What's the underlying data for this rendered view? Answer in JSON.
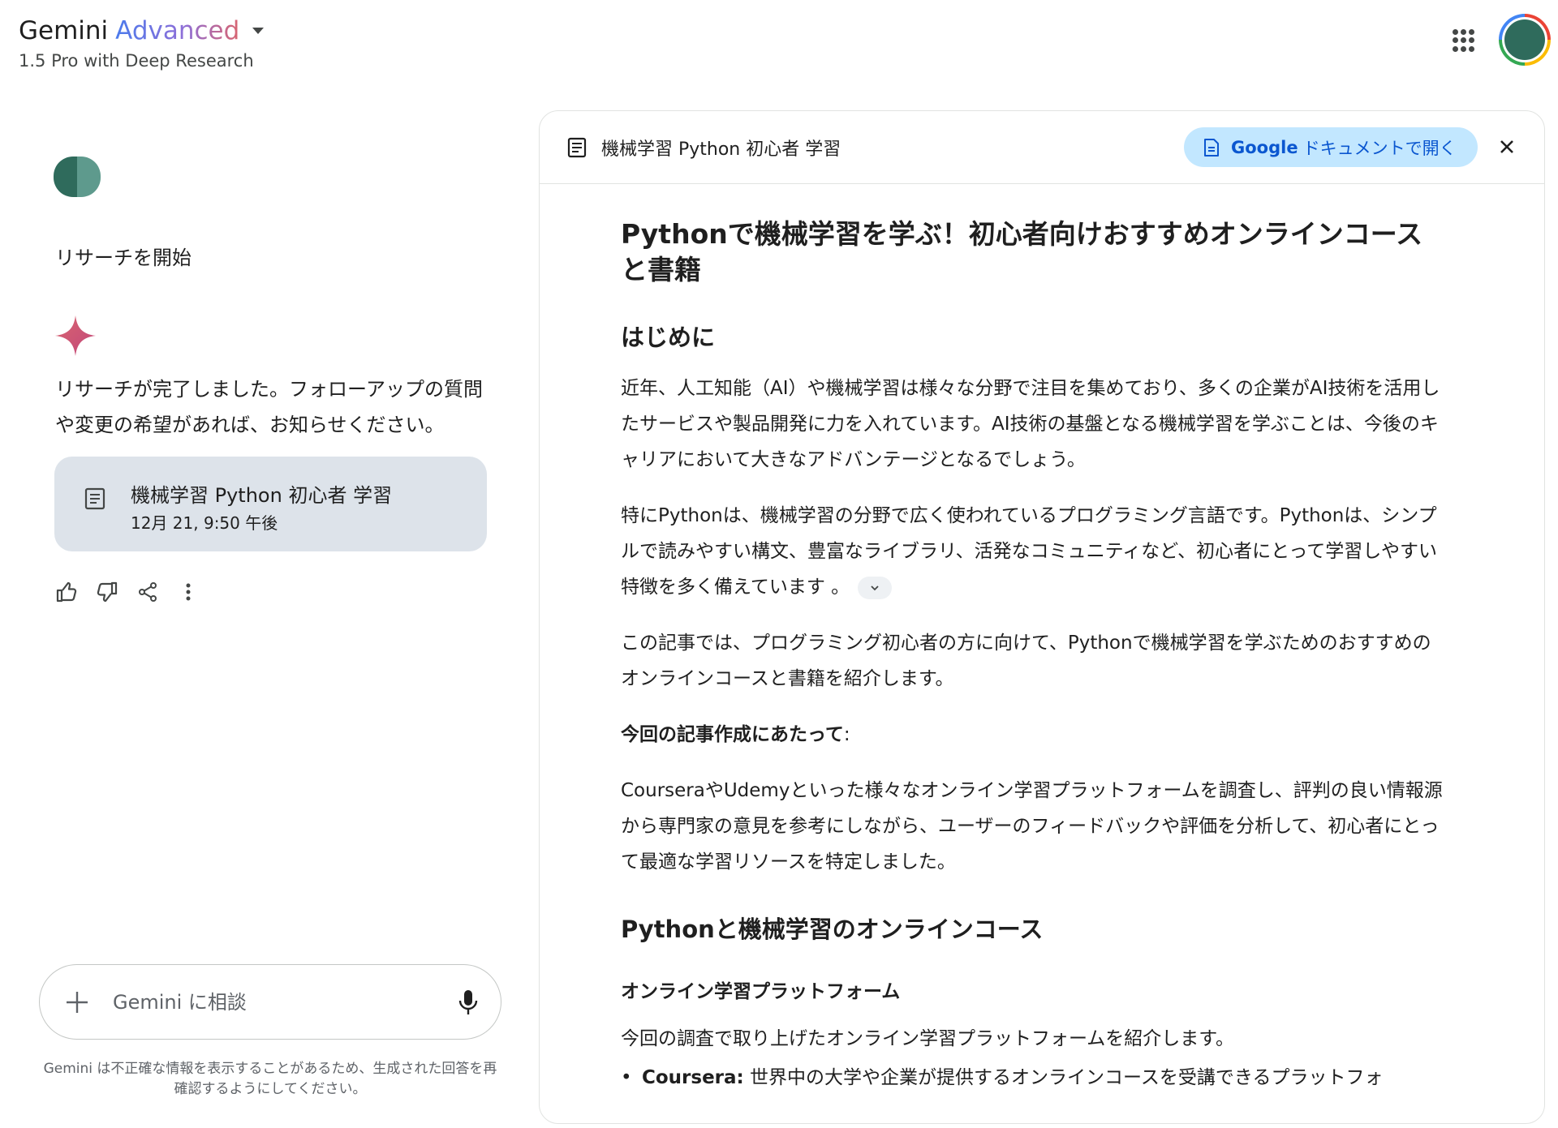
{
  "header": {
    "brand_name": "Gemini",
    "brand_tier": "Advanced",
    "model_label": "1.5 Pro with Deep Research"
  },
  "conversation": {
    "user_message": "リサーチを開始",
    "assistant_reply": "リサーチが完了しました。フォローアップの質問や変更の希望があれば、お知らせください。",
    "doc_card": {
      "title": "機械学習 Python 初心者 学習",
      "date": "12月 21, 9:50 午後"
    }
  },
  "composer": {
    "placeholder": "Gemini に相談",
    "disclaimer": "Gemini は不正確な情報を表示することがあるため、生成された回答を再確認するようにしてください。"
  },
  "panel": {
    "title": "機械学習 Python 初心者 学習",
    "open_button_brand": "Google",
    "open_button_label": "ドキュメントで開く"
  },
  "article": {
    "title": "Pythonで機械学習を学ぶ！初心者向けおすすめオンラインコースと書籍",
    "intro_heading": "はじめに",
    "para1": "近年、人工知能（AI）や機械学習は様々な分野で注目を集めており、多くの企業がAI技術を活用したサービスや製品開発に力を入れています。AI技術の基盤となる機械学習を学ぶことは、今後のキャリアにおいて大きなアドバンテージとなるでしょう。",
    "para2": "特にPythonは、機械学習の分野で広く使われているプログラミング言語です。Pythonは、シンプルで読みやすい構文、豊富なライブラリ、活発なコミュニティなど、初心者にとって学習しやすい特徴を多く備えています 。",
    "para3": "この記事では、プログラミング初心者の方に向けて、Pythonで機械学習を学ぶためのおすすめのオンラインコースと書籍を紹介します。",
    "note_label": "今回の記事作成にあたって",
    "note_colon": ":",
    "para4": "CourseraやUdemyといった様々なオンライン学習プラットフォームを調査し、評判の良い情報源から専門家の意見を参考にしながら、ユーザーのフィードバックや評価を分析して、初心者にとって最適な学習リソースを特定しました。",
    "section_heading": "Pythonと機械学習のオンラインコース",
    "subsection_heading": "オンライン学習プラットフォーム",
    "para5": "今回の調査で取り上げたオンライン学習プラットフォームを紹介します。",
    "bullet_label": "Coursera:",
    "bullet_text": " 世界中の大学や企業が提供するオンラインコースを受講できるプラットフォ"
  }
}
